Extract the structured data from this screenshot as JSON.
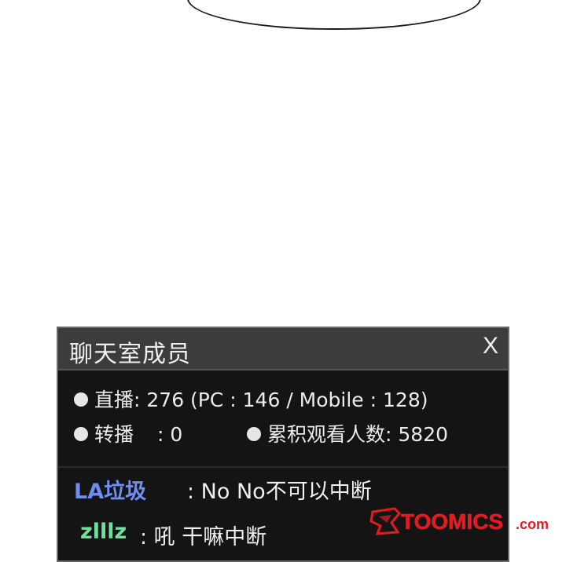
{
  "chat_panel": {
    "title": "聊天室成员",
    "close_label": "X",
    "stats": {
      "live_label": "直播",
      "live_value": ": 276 (PC : 146 / Mobile : 128)",
      "rebroadcast_label": "转播",
      "rebroadcast_value": ": 0",
      "cumulative_label": "累积观看人数",
      "cumulative_value": ": 5820"
    },
    "messages": [
      {
        "user": "LA垃圾",
        "text": ": No No不可以中断",
        "user_color": "#6f8ff0"
      },
      {
        "user": "zlllz",
        "text": ": 吼 干嘛中断",
        "user_color": "#6fe0a0"
      }
    ]
  },
  "watermark": {
    "text": "TOOMICS",
    "suffix": ".com",
    "color": "#e21b23"
  }
}
